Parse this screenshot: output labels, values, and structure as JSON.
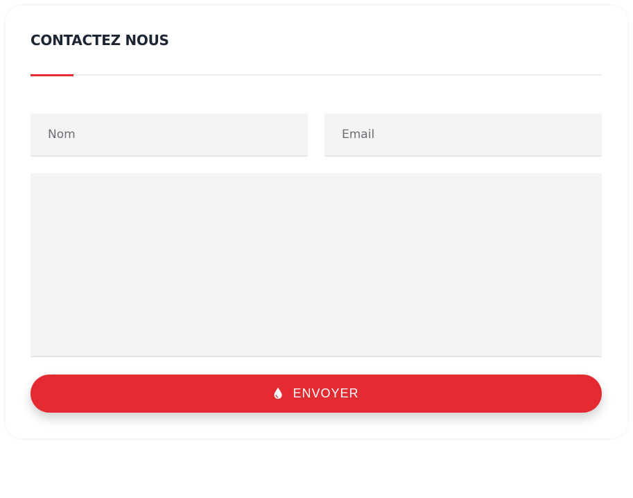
{
  "contact": {
    "title": "CONTACTEZ NOUS",
    "name_placeholder": "Nom",
    "email_placeholder": "Email",
    "message_placeholder": "",
    "submit_label": "ENVOYER",
    "submit_icon": "drop-icon",
    "accent_color": "#e42b31"
  }
}
